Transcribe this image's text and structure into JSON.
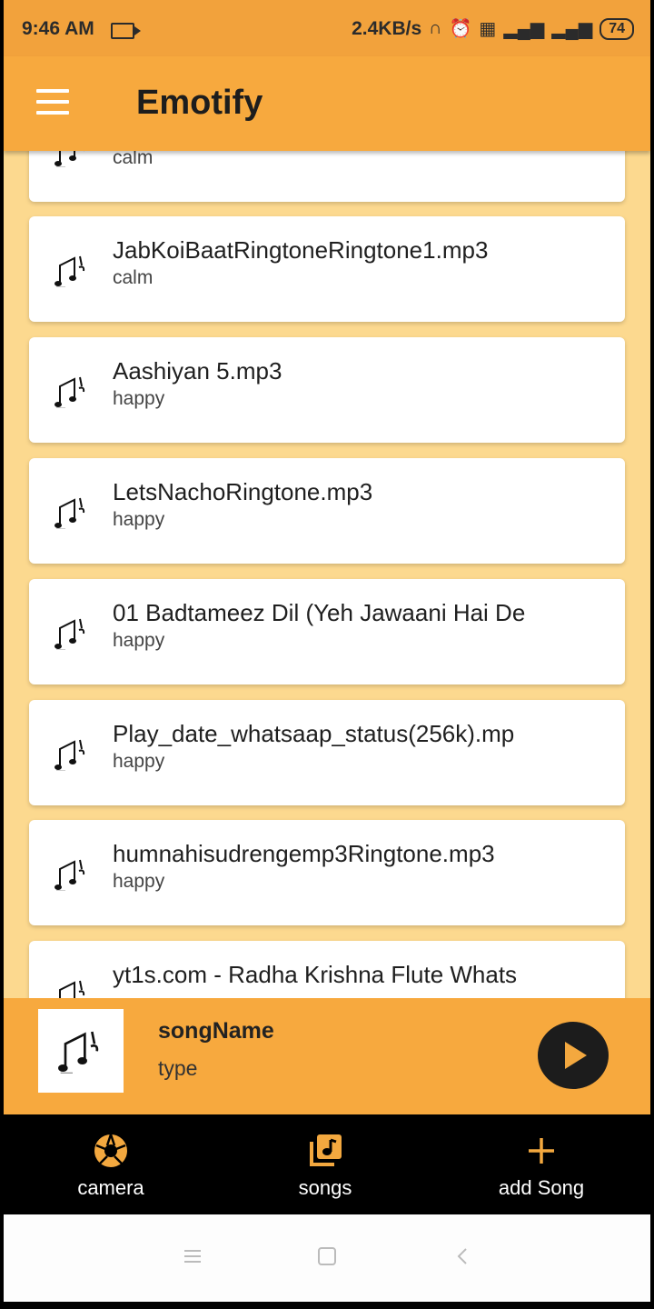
{
  "status_bar": {
    "time": "9:46 AM",
    "network_speed": "2.4KB/s",
    "battery": "74",
    "icons": [
      "video-record-icon",
      "headset-icon",
      "alarm-icon",
      "volte-icon",
      "signal-icon",
      "signal-icon"
    ]
  },
  "app_bar": {
    "title": "Emotify",
    "menu_icon": "hamburger-menu-icon"
  },
  "songs": [
    {
      "title": "",
      "type": "calm"
    },
    {
      "title": "JabKoiBaatRingtoneRingtone1.mp3",
      "type": "calm"
    },
    {
      "title": "Aashiyan 5.mp3",
      "type": "happy"
    },
    {
      "title": "LetsNachoRingtone.mp3",
      "type": "happy"
    },
    {
      "title": "01 Badtameez Dil (Yeh Jawaani Hai De",
      "type": "happy"
    },
    {
      "title": "Play_date_whatsaap_status(256k).mp",
      "type": "happy"
    },
    {
      "title": "humnahisudrengemp3Ringtone.mp3",
      "type": "happy"
    },
    {
      "title": "yt1s.com - Radha Krishna Flute  Whats",
      "type": ""
    }
  ],
  "player": {
    "song_name": "songName",
    "song_type": "type",
    "play_icon": "play-icon"
  },
  "bottom_nav": {
    "items": [
      {
        "label": "camera",
        "icon": "camera-aperture-icon"
      },
      {
        "label": "songs",
        "icon": "music-library-icon"
      },
      {
        "label": "add Song",
        "icon": "plus-icon"
      }
    ]
  },
  "system_nav": {
    "icons": [
      "recents-icon",
      "home-icon",
      "back-icon"
    ]
  },
  "colors": {
    "accent": "#f7a93e",
    "list_background": "#fcd98f",
    "nav_background": "#000000",
    "icon_accent": "#f3a83f"
  }
}
